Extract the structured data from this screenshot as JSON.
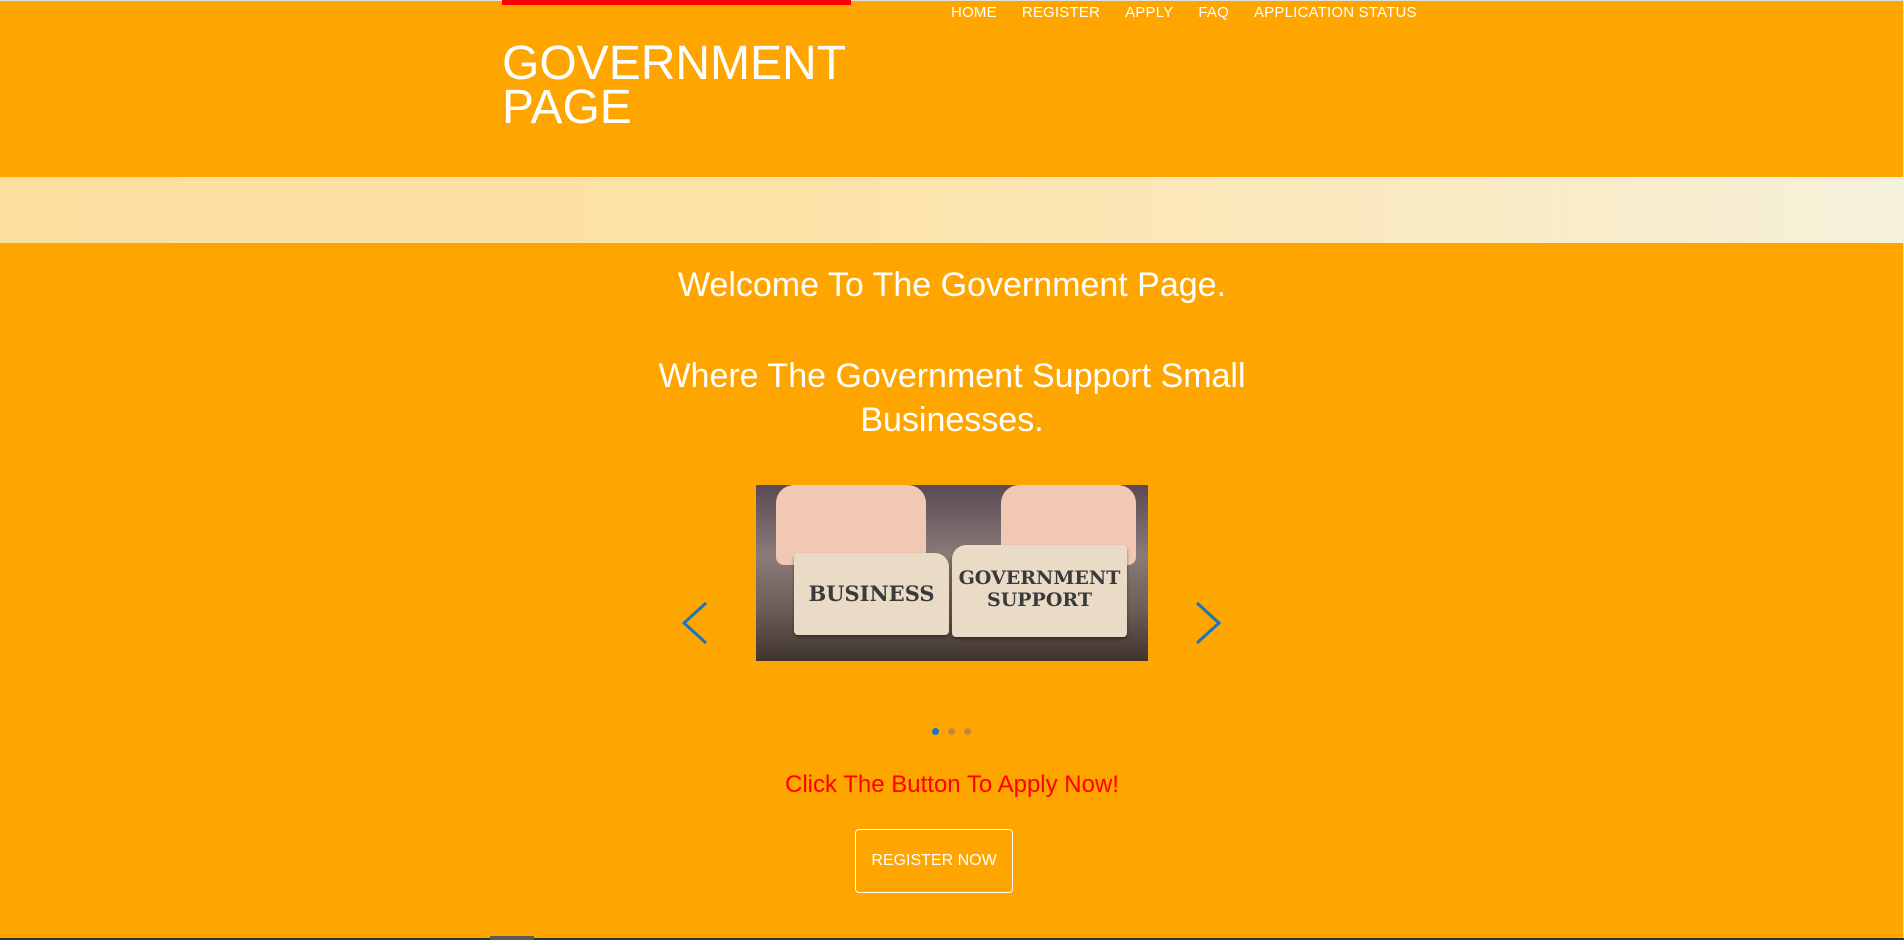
{
  "header": {
    "site_title": "GOVERNMENT PAGE",
    "nav": [
      "HOME",
      "REGISTER",
      "APPLY",
      "FAQ",
      "APPLICATION STATUS"
    ]
  },
  "hero": {
    "welcome_line_1": "Welcome To The Government Page.",
    "welcome_line_2": "Where The Government Support Small Businesses."
  },
  "carousel": {
    "slide_left_text": "BUSINESS",
    "slide_right_text": "GOVERNMENT SUPPORT",
    "dot_count": 3,
    "active_dot": 1
  },
  "cta": {
    "text": "Click The Button To Apply Now!",
    "button_label": "REGISTER NOW"
  },
  "colors": {
    "background": "#ffa500",
    "accent_bar": "#ff0000",
    "cta_text": "#ff0000",
    "arrow": "#1e73be"
  }
}
